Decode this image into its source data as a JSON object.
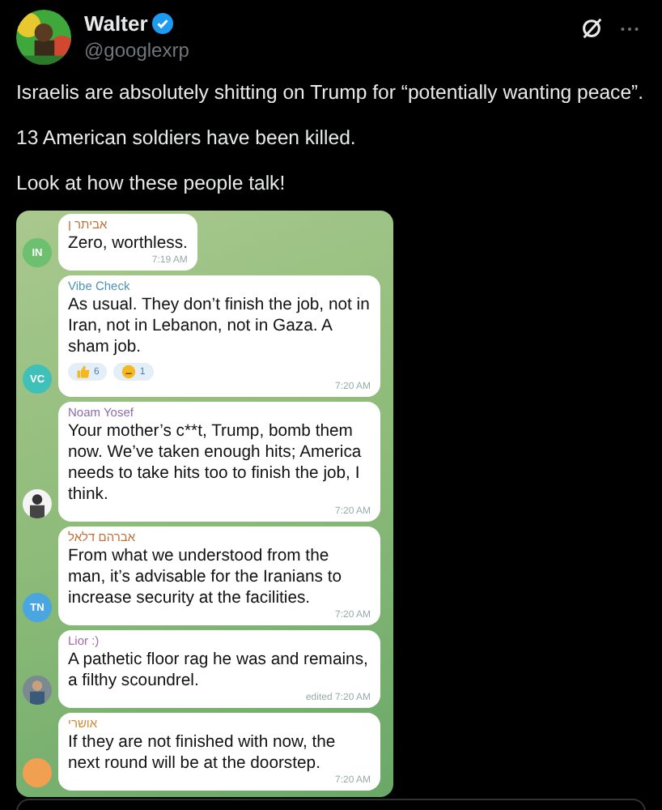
{
  "post": {
    "author": "Walter",
    "verified": true,
    "handle": "@googlexrp",
    "paragraphs": [
      "Israelis are absolutely shitting on Trump for “potentially wanting peace”.",
      "13 American soldiers have been killed.",
      "Look at how these people talk!"
    ]
  },
  "chat": {
    "messages": [
      {
        "sender": "אביתר ן",
        "color": "#c0703a",
        "text": "Zero, worthless.",
        "time": "7:19 AM",
        "avatar": {
          "kind": "initials",
          "initials": "IN",
          "color": "#6cc070"
        }
      },
      {
        "sender": "Vibe Check",
        "color": "#4f93b0",
        "text": "As usual. They don’t finish the job, not in Iran, not in Lebanon, not in Gaza. A sham job.",
        "time": "7:20 AM",
        "reactions": [
          "6",
          "1"
        ],
        "avatar": {
          "kind": "initials",
          "initials": "VC",
          "color": "#3fc0b8"
        }
      },
      {
        "sender": "Noam Yosef",
        "color": "#8e6ab0",
        "text": "Your mother’s c**t, Trump, bomb them now. We’ve taken enough hits; America needs to take hits too to finish the job, I think.",
        "time": "7:20 AM"
      },
      {
        "sender": "אברהם דלאל",
        "color": "#c0703a",
        "text": "From what we understood from the man, it’s advisable for the Iranians to increase security at the facilities.",
        "time": "7:20 AM",
        "avatar": {
          "kind": "initials",
          "initials": "TN",
          "color": "#4aa6e0"
        }
      },
      {
        "sender": "Lior :)",
        "color": "#a86aa8",
        "text": "A pathetic floor rag he was and remains, a filthy scoundrel.",
        "time": "edited 7:20 AM"
      },
      {
        "sender": "אושרי",
        "color": "#d08a3a",
        "text": "If they are not finished with now, the next round will be at the doorstep.",
        "time": "7:20 AM",
        "avatar": {
          "kind": "blank",
          "color": "#f0a050"
        }
      }
    ]
  }
}
